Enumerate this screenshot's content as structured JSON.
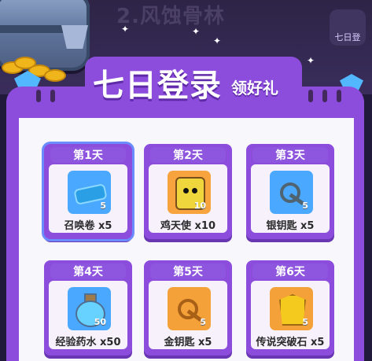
{
  "background": {
    "title": "2.风蚀骨林",
    "corner_logo_text": "七日登"
  },
  "header": {
    "main_title": "七日登录",
    "sub_title": "领好礼"
  },
  "rewards": [
    {
      "day_label": "第1天",
      "item_name": "召唤卷 x5",
      "quantity": "5",
      "icon": "ticket-icon",
      "active": true
    },
    {
      "day_label": "第2天",
      "item_name": "鸡天使 x10",
      "quantity": "10",
      "icon": "chicken-angel-icon",
      "active": false
    },
    {
      "day_label": "第3天",
      "item_name": "银钥匙 x5",
      "quantity": "5",
      "icon": "silver-key-icon",
      "active": false
    },
    {
      "day_label": "第4天",
      "item_name": "经验药水 x50",
      "quantity": "50",
      "icon": "potion-icon",
      "active": false
    },
    {
      "day_label": "第5天",
      "item_name": "金钥匙 x5",
      "quantity": "5",
      "icon": "gold-key-icon",
      "active": false
    },
    {
      "day_label": "第6天",
      "item_name": "传说突破石 x5",
      "quantity": "5",
      "icon": "legend-stone-icon",
      "active": false
    }
  ],
  "colors": {
    "panel_purple": "#8c4ddd",
    "card_purple": "#8e55df",
    "white_panel": "#f8f7fb"
  }
}
